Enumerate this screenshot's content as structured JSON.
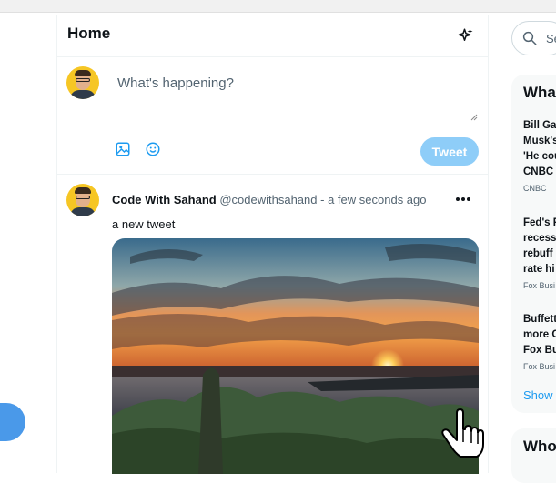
{
  "header": {
    "title": "Home",
    "sparkle_icon": "sparkle-icon"
  },
  "composer": {
    "placeholder": "What's happening?",
    "tweet_label": "Tweet",
    "icons": [
      "image-icon",
      "emoji-icon"
    ]
  },
  "tweet": {
    "name": "Code With Sahand",
    "handle": "@codewithsahand",
    "separator": "-",
    "time": "a few seconds ago",
    "text": "a new tweet",
    "more_icon": "more-icon"
  },
  "sidebar": {
    "search_placeholder": "Se",
    "trends_title": "Wha",
    "trends": [
      {
        "lines": [
          "Bill Gat",
          "Musk's",
          "'He cou",
          "CNBC"
        ],
        "source": "CNBC"
      },
      {
        "lines": [
          "Fed's P",
          "recessi",
          "rebuff",
          "rate hi"
        ],
        "source": "Fox Busi"
      },
      {
        "lines": [
          "Buffett",
          "more C",
          "Fox Bu"
        ],
        "source": "Fox Busi"
      }
    ],
    "show_more": "Show",
    "who_title": "Who"
  },
  "colors": {
    "accent": "#1d9bf0",
    "tweet_button": "#8ecdf8",
    "avatar_bg": "#f6c624"
  }
}
